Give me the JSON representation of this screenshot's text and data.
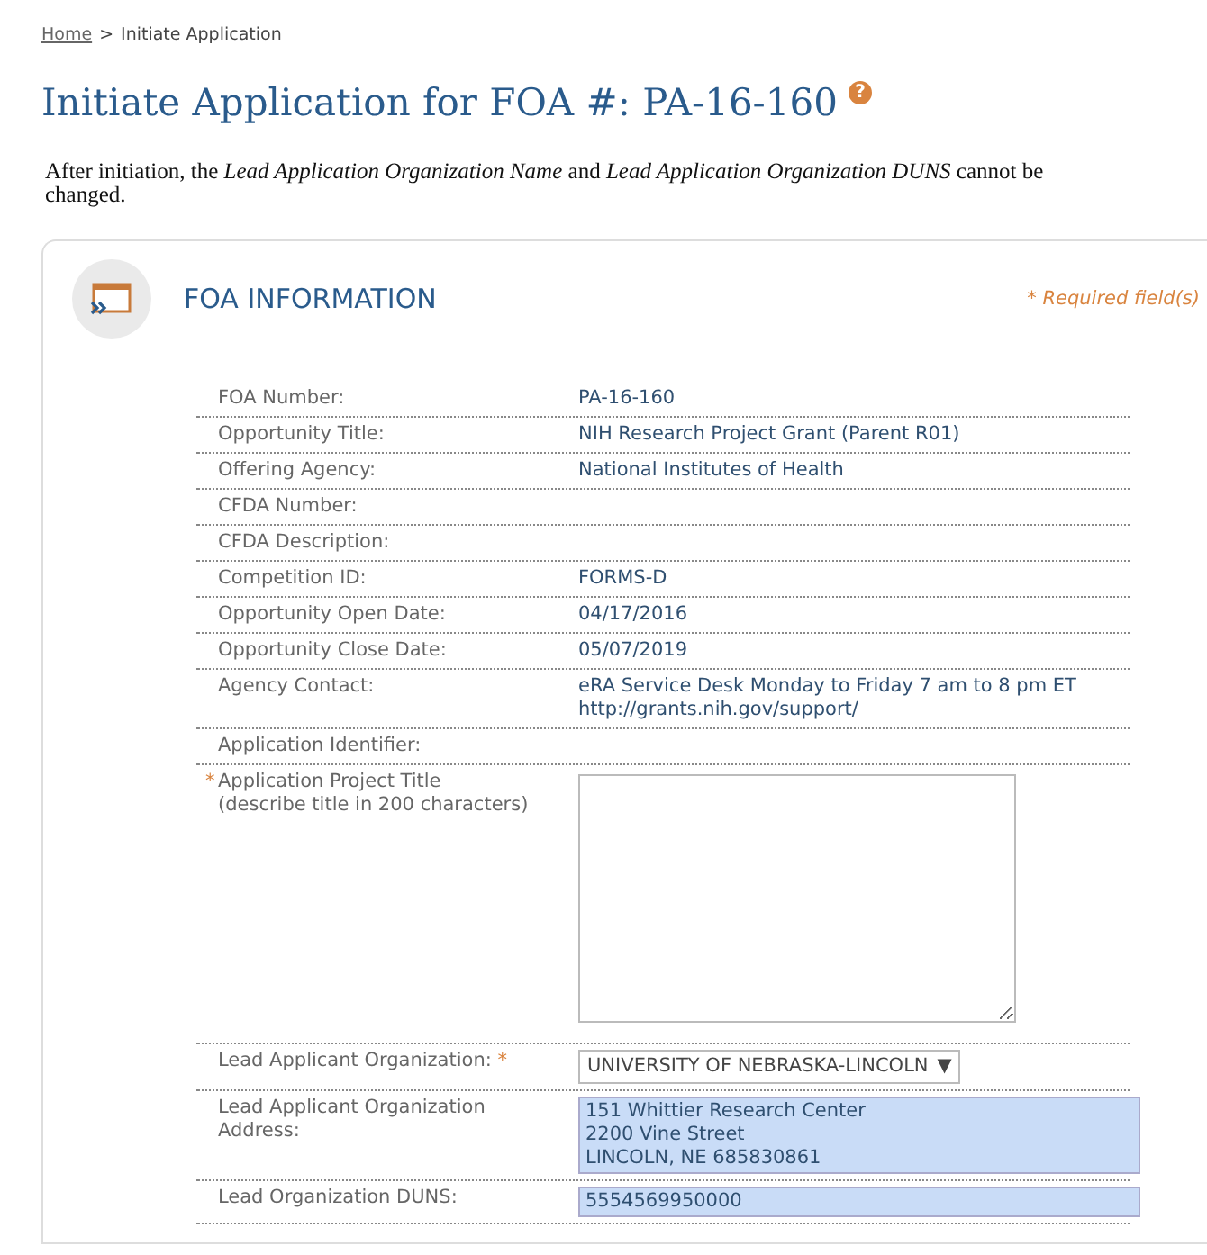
{
  "breadcrumb": {
    "link": "Home",
    "separator": ">",
    "current": "Initiate Application"
  },
  "title": "Initiate Application for FOA #: PA-16-160",
  "help_icon": "?",
  "notice": "After initiation, the *Lead Application Organization Name* and *Lead Application Organization DUNS* cannot be changed.",
  "section": {
    "title": "FOA INFORMATION",
    "required_note": "* Required field(s)",
    "rows": [
      {
        "kind": "text",
        "label": "FOA Number:",
        "value": "PA-16-160"
      },
      {
        "kind": "text",
        "label": "Opportunity Title:",
        "value": "NIH Research Project Grant (Parent R01)"
      },
      {
        "kind": "text",
        "label": "Offering Agency:",
        "value": "National Institutes of Health"
      },
      {
        "kind": "text",
        "label": "CFDA Number:"
      },
      {
        "kind": "text",
        "label": "CFDA Description:"
      },
      {
        "kind": "text",
        "label": "Competition ID:",
        "value": "FORMS-D"
      },
      {
        "kind": "text",
        "label": "Opportunity Open Date:",
        "value": "04/17/2016"
      },
      {
        "kind": "text",
        "label": "Opportunity Close Date:",
        "value": "05/07/2019"
      },
      {
        "kind": "text",
        "label": "Agency Contact:",
        "value": "eRA Service Desk Monday to Friday 7 am to 8 pm ET\nhttp://grants.nih.gov/support/"
      },
      {
        "kind": "text",
        "label": "Application Identifier:"
      },
      {
        "kind": "textarea",
        "label": "Application Project Title\n(describe title in 200 characters)",
        "mark_before": "*"
      },
      {
        "kind": "select",
        "label": "Lead Applicant Organization:",
        "mark_after": "*",
        "value": "UNIVERSITY OF NEBRASKA-LINCOLN",
        "caret": "▼"
      },
      {
        "kind": "readonly",
        "label": "Lead Applicant Organization\nAddress:",
        "value": "151 Whittier Research Center\n2200 Vine Street\nLINCOLN, NE 685830861"
      },
      {
        "kind": "readonly",
        "label": "Lead Organization DUNS:",
        "value": "5554569950000"
      }
    ]
  }
}
